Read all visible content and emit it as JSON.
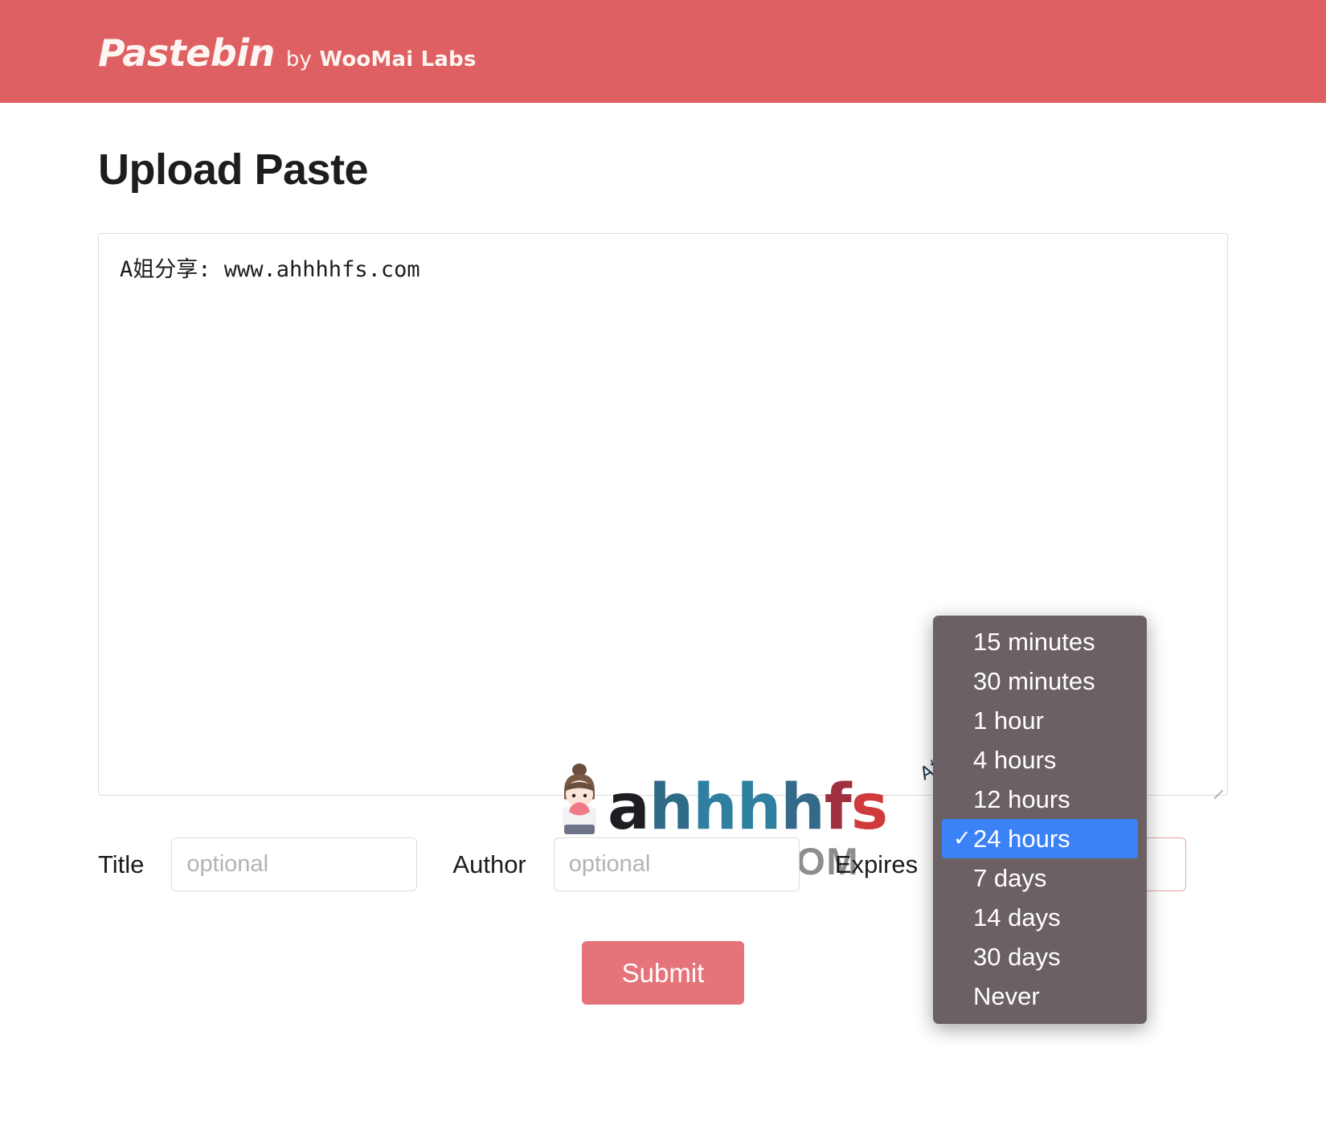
{
  "header": {
    "brand_name": "Pastebin",
    "brand_by": "by",
    "brand_owner": "WooMai Labs"
  },
  "main": {
    "page_title": "Upload Paste",
    "paste_content": "A姐分享: www.ahhhhfs.com",
    "paste_placeholder": ""
  },
  "watermark": {
    "word_a": "a",
    "word_h1": "h",
    "word_h2": "h",
    "word_h3": "h",
    "word_h4": "h",
    "word_f": "f",
    "word_s": "s",
    "domain": "AHHHHFS.COM",
    "cn_tag": "A姐分享",
    "colors": {
      "a": "#1d1d22",
      "h1": "#2f6b86",
      "h2": "#2f7fa0",
      "h3": "#2f7fa0",
      "h4": "#35698a",
      "f": "#a03040",
      "s": "#cf3b3b",
      "domain": "#8d8d8d"
    }
  },
  "form": {
    "title_label": "Title",
    "title_value": "",
    "title_placeholder": "optional",
    "author_label": "Author",
    "author_value": "",
    "author_placeholder": "optional",
    "expires_label": "Expires",
    "expires_value": "24 hours"
  },
  "submit": {
    "label": "Submit"
  },
  "expires_dropdown": {
    "selected": "24 hours",
    "check_glyph": "✓",
    "options": [
      "15 minutes",
      "30 minutes",
      "1 hour",
      "4 hours",
      "12 hours",
      "24 hours",
      "7 days",
      "14 days",
      "30 days",
      "Never"
    ]
  },
  "colors": {
    "header_bg": "#df6063",
    "submit_bg": "#e4737a",
    "dropdown_bg": "#6b6063",
    "dropdown_selected": "#3b82f6",
    "select_border": "#e6a2a2"
  }
}
